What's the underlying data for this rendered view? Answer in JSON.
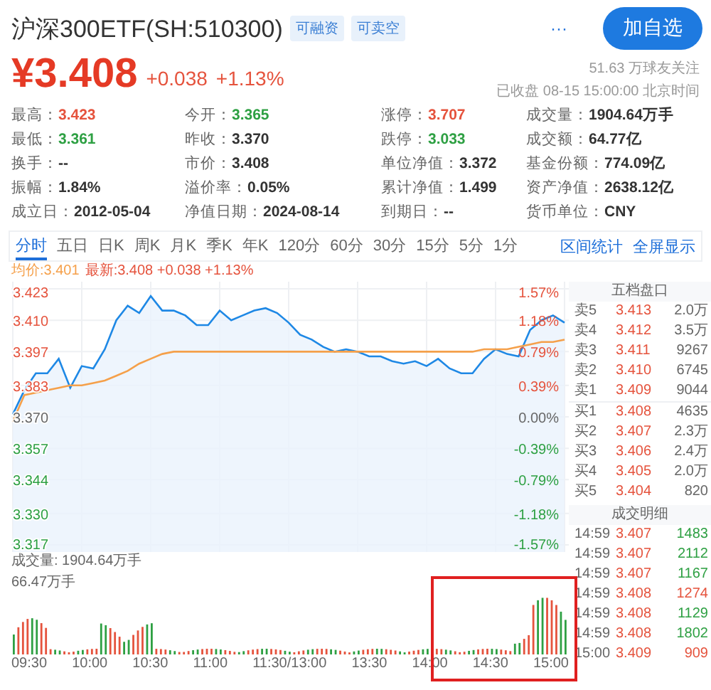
{
  "header": {
    "title": "沪深300ETF(SH:510300)",
    "badges": [
      "可融资",
      "可卖空"
    ],
    "more": "···",
    "follow_button": "加自选"
  },
  "quote": {
    "price": "¥3.408",
    "change": "+0.038",
    "change_pct": "+1.13%",
    "followers": "51.63 万球友关注",
    "status": "已收盘 08-15 15:00:00 北京时间"
  },
  "stats": [
    [
      {
        "label": "最高：",
        "value": "3.423",
        "kind": "up"
      },
      {
        "label": "今开：",
        "value": "3.365",
        "kind": "down"
      },
      {
        "label": "涨停：",
        "value": "3.707",
        "kind": "up"
      },
      {
        "label": "成交量：",
        "value": "1904.64万手",
        "kind": "plain"
      }
    ],
    [
      {
        "label": "最低：",
        "value": "3.361",
        "kind": "down"
      },
      {
        "label": "昨收：",
        "value": "3.370",
        "kind": "plain"
      },
      {
        "label": "跌停：",
        "value": "3.033",
        "kind": "down"
      },
      {
        "label": "成交额：",
        "value": "64.77亿",
        "kind": "plain"
      }
    ],
    [
      {
        "label": "换手：",
        "value": "--",
        "kind": "plain"
      },
      {
        "label": "市价：",
        "value": "3.408",
        "kind": "plain"
      },
      {
        "label": "单位净值：",
        "value": "3.372",
        "kind": "plain"
      },
      {
        "label": "基金份额：",
        "value": "774.09亿",
        "kind": "plain"
      }
    ],
    [
      {
        "label": "振幅：",
        "value": "1.84%",
        "kind": "plain"
      },
      {
        "label": "溢价率：",
        "value": "0.05%",
        "kind": "plain"
      },
      {
        "label": "累计净值：",
        "value": "1.499",
        "kind": "plain"
      },
      {
        "label": "资产净值：",
        "value": "2638.12亿",
        "kind": "plain"
      }
    ],
    [
      {
        "label": "成立日：",
        "value": "2012-05-04",
        "kind": "plain"
      },
      {
        "label": "净值日期：",
        "value": "2024-08-14",
        "kind": "plain"
      },
      {
        "label": "到期日：",
        "value": "--",
        "kind": "plain"
      },
      {
        "label": "货币单位：",
        "value": "CNY",
        "kind": "plain"
      }
    ]
  ],
  "tabs": [
    {
      "label": "分时",
      "selected": true
    },
    {
      "label": "五日",
      "selected": false
    },
    {
      "label": "日K",
      "selected": false
    },
    {
      "label": "周K",
      "selected": false
    },
    {
      "label": "月K",
      "selected": false
    },
    {
      "label": "季K",
      "selected": false
    },
    {
      "label": "年K",
      "selected": false
    },
    {
      "label": "120分",
      "selected": false
    },
    {
      "label": "60分",
      "selected": false
    },
    {
      "label": "30分",
      "selected": false
    },
    {
      "label": "15分",
      "selected": false
    },
    {
      "label": "5分",
      "selected": false
    },
    {
      "label": "1分",
      "selected": false
    }
  ],
  "tab_links": [
    "区间统计",
    "全屏显示"
  ],
  "legend": {
    "average": "均价:3.401",
    "latest": "最新:3.408 +0.038 +1.13%"
  },
  "chart_data": {
    "type": "line",
    "grid": true,
    "categories": [
      null,
      null,
      null,
      null,
      null,
      null,
      null,
      null,
      null,
      null,
      null,
      null,
      null,
      null,
      null,
      null,
      null,
      null,
      null,
      null,
      null,
      null,
      null,
      null,
      null,
      null,
      null,
      null,
      null,
      null,
      null,
      null,
      null,
      null,
      null,
      null,
      null,
      null,
      null,
      null,
      null,
      null,
      null,
      null,
      null,
      null,
      null,
      null,
      null
    ],
    "series": [
      {
        "color": "#1e88e5",
        "values": [
          3.371,
          3.381,
          3.388,
          3.388,
          3.394,
          3.382,
          3.391,
          3.39,
          3.398,
          3.41,
          3.416,
          3.413,
          3.42,
          3.414,
          3.414,
          3.412,
          3.408,
          3.408,
          3.414,
          3.41,
          3.412,
          3.414,
          3.415,
          3.413,
          3.409,
          3.404,
          3.402,
          3.399,
          3.397,
          3.398,
          3.397,
          3.395,
          3.395,
          3.393,
          3.392,
          3.393,
          3.391,
          3.394,
          3.39,
          3.388,
          3.388,
          3.394,
          3.398,
          3.396,
          3.395,
          3.406,
          3.41,
          3.412,
          3.409
        ]
      },
      {
        "color": "#f5a04a",
        "values": [
          3.368,
          3.379,
          3.38,
          3.381,
          3.382,
          3.383,
          3.383,
          3.384,
          3.385,
          3.387,
          3.389,
          3.392,
          3.394,
          3.396,
          3.397,
          3.397,
          3.397,
          3.397,
          3.397,
          3.397,
          3.397,
          3.397,
          3.397,
          3.397,
          3.397,
          3.397,
          3.397,
          3.397,
          3.397,
          3.397,
          3.397,
          3.397,
          3.397,
          3.397,
          3.397,
          3.397,
          3.397,
          3.397,
          3.397,
          3.397,
          3.397,
          3.398,
          3.398,
          3.398,
          3.399,
          3.4,
          3.401,
          3.401,
          3.402
        ]
      }
    ],
    "ylim": [
      3.317,
      3.423
    ],
    "yticks": [
      {
        "value": 3.423,
        "label": "3.423"
      },
      {
        "value": 3.41,
        "label": "3.410"
      },
      {
        "value": 3.397,
        "label": "3.397"
      },
      {
        "value": 3.383,
        "label": "3.383"
      },
      {
        "value": 3.37,
        "label": "3.370"
      },
      {
        "value": 3.357,
        "label": "3.357"
      },
      {
        "value": 3.344,
        "label": "3.344"
      },
      {
        "value": 3.33,
        "label": "3.330"
      },
      {
        "value": 3.317,
        "label": "3.317"
      }
    ]
  },
  "percent_ticks": [
    "1.57%",
    "1.18%",
    "0.79%",
    "0.39%",
    "0.00%",
    "-0.39%",
    "-0.79%",
    "-1.18%",
    "-1.57%"
  ],
  "volume": {
    "label": "成交量: 1904.64万手",
    "max": "66.47万手"
  },
  "time_axis": [
    "09:30",
    "10:00",
    "10:30",
    "11:00",
    "11:30/13:00",
    "13:30",
    "14:00",
    "14:30",
    "15:00"
  ],
  "order_book": {
    "title": "五档盘口",
    "rows": [
      {
        "label": "卖5",
        "price": "3.413",
        "volume": "2.0万"
      },
      {
        "label": "卖4",
        "price": "3.412",
        "volume": "3.5万"
      },
      {
        "label": "卖3",
        "price": "3.411",
        "volume": "9267"
      },
      {
        "label": "卖2",
        "price": "3.410",
        "volume": "6745"
      },
      {
        "label": "卖1",
        "price": "3.409",
        "volume": "9044"
      },
      {
        "label": "买1",
        "price": "3.408",
        "volume": "4635"
      },
      {
        "label": "买2",
        "price": "3.407",
        "volume": "2.3万"
      },
      {
        "label": "买3",
        "price": "3.406",
        "volume": "2.4万"
      },
      {
        "label": "买4",
        "price": "3.405",
        "volume": "2.0万"
      },
      {
        "label": "买5",
        "price": "3.404",
        "volume": "820"
      }
    ]
  },
  "trades": {
    "title": "成交明细",
    "rows": [
      {
        "time": "14:59",
        "price": "3.407",
        "volume": "1483",
        "color": "#2ea043"
      },
      {
        "time": "14:59",
        "price": "3.407",
        "volume": "2112",
        "color": "#2ea043"
      },
      {
        "time": "14:59",
        "price": "3.407",
        "volume": "1167",
        "color": "#2ea043"
      },
      {
        "time": "14:59",
        "price": "3.408",
        "volume": "1274",
        "color": "#e5533d"
      },
      {
        "time": "14:59",
        "price": "3.408",
        "volume": "1129",
        "color": "#2ea043"
      },
      {
        "time": "14:59",
        "price": "3.408",
        "volume": "1802",
        "color": "#2ea043"
      },
      {
        "time": "15:00",
        "price": "3.409",
        "volume": "909",
        "color": "#e5533d"
      }
    ]
  }
}
